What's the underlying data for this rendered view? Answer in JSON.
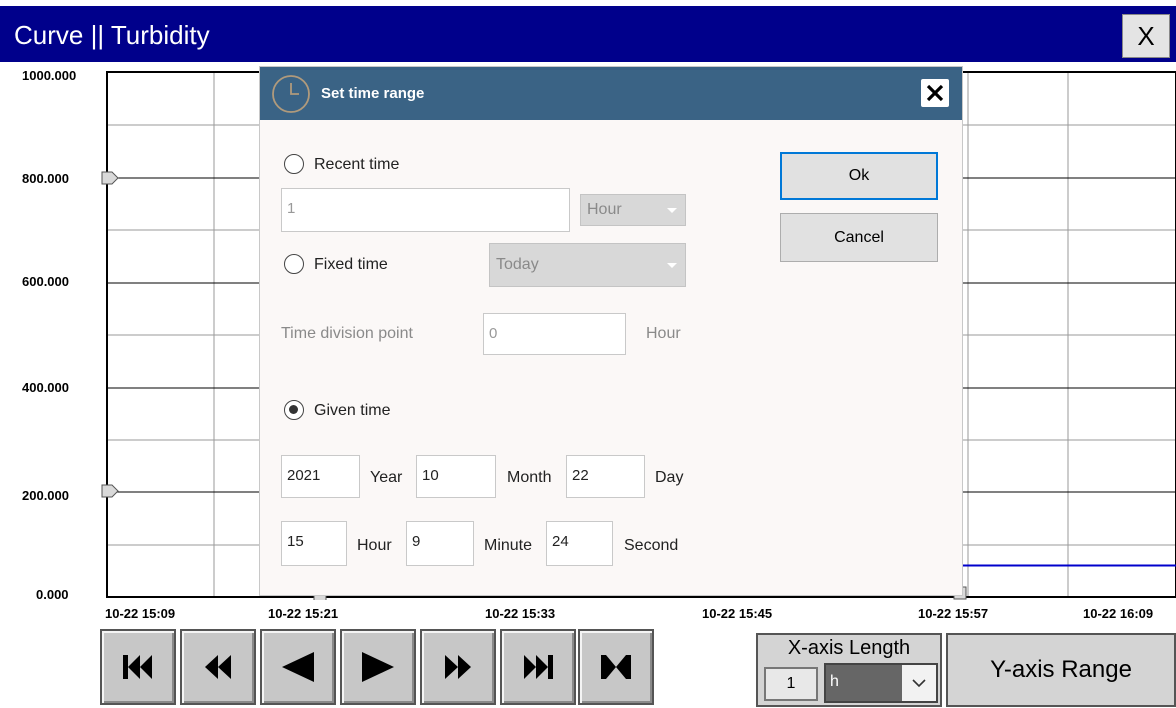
{
  "window": {
    "title": "Curve || Turbidity",
    "close_label": "X"
  },
  "chart_data": {
    "type": "line",
    "series": [
      {
        "color": "#0000cc",
        "x": [
          "10-22 15:57",
          "10-22 16:09"
        ],
        "values": [
          60,
          60
        ]
      }
    ],
    "ylim": [
      0,
      1000
    ],
    "y_tick_labels": [
      "1000.000",
      "800.000",
      "600.000",
      "400.000",
      "200.000",
      "0.000"
    ],
    "x_tick_labels": [
      "10-22 15:09",
      "10-22 15:21",
      "10-22 15:33",
      "10-22 15:45",
      "10-22 15:57",
      "10-22 16:09"
    ],
    "grid": true
  },
  "toolbar": {
    "buttons": [
      {
        "icon": "skip-to-start-icon"
      },
      {
        "icon": "fast-backward-icon"
      },
      {
        "icon": "step-backward-icon"
      },
      {
        "icon": "step-forward-icon"
      },
      {
        "icon": "fast-forward-icon"
      },
      {
        "icon": "skip-to-end-icon"
      },
      {
        "icon": "jump-to-now-icon"
      }
    ],
    "x_axis_length": {
      "title": "X-axis Length",
      "value": "1",
      "unit": "h"
    },
    "y_axis_range_label": "Y-axis Range"
  },
  "dialog": {
    "title": "Set time range",
    "recent_time": {
      "label": "Recent time",
      "value": "1",
      "unit": "Hour",
      "selected": false
    },
    "fixed_time": {
      "label": "Fixed time",
      "value": "Today",
      "selected": false
    },
    "time_division": {
      "label": "Time division point",
      "value": "0",
      "unit": "Hour"
    },
    "given_time": {
      "label": "Given time",
      "selected": true,
      "year": "2021",
      "year_label": "Year",
      "month": "10",
      "month_label": "Month",
      "day": "22",
      "day_label": "Day",
      "hour": "15",
      "hour_label": "Hour",
      "minute": "9",
      "minute_label": "Minute",
      "second": "24",
      "second_label": "Second"
    },
    "ok_label": "Ok",
    "cancel_label": "Cancel"
  },
  "colors": {
    "titlebar": "#00008b",
    "dialog_header": "#3a6385",
    "series": "#0000cc",
    "ok_border": "#0078d7"
  }
}
